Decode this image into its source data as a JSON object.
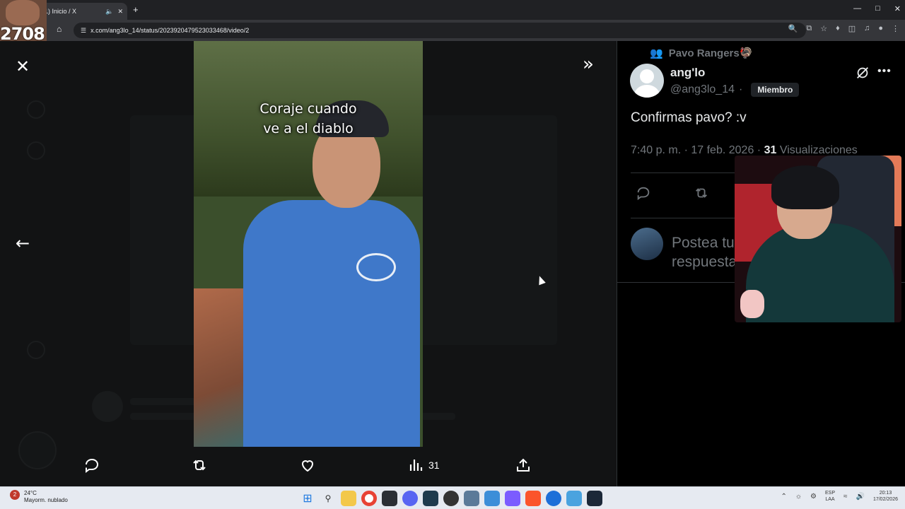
{
  "browser": {
    "tab_title": "(1) Inicio / X",
    "url": "x.com/ang3lo_14/status/2023920479523033468/video/2",
    "new_tab_icon": "plus-icon",
    "window_controls": [
      "minimize-icon",
      "restore-icon",
      "close-icon"
    ]
  },
  "overlay": {
    "streamer_number": "2708"
  },
  "viewer": {
    "video_caption_line1": "Coraje cuando",
    "video_caption_line2": "ve a el diablo",
    "close_icon": "close-icon",
    "expand_icon": "expand-panel-icon",
    "prev_icon": "arrow-left-icon",
    "views_count": "31"
  },
  "tweet": {
    "community": "Pavo Rangers🦃",
    "name": "ang'lo",
    "handle": "@ang3lo_14",
    "separator": "·",
    "member_badge": "Miembro",
    "text": "Confirmas pavo? :v",
    "timestamp": "7:40 p. m. · 17 feb. 2026 ·",
    "views_number": "31",
    "views_label": "Visualizaciones",
    "reply_placeholder": "Postea tu respuesta"
  },
  "taskbar": {
    "temperature": "24°C",
    "weather": "Mayorm. nublado",
    "notification_count": "2",
    "lang_top": "ESP",
    "lang_bottom": "LAA",
    "time": "20:13",
    "date": "17/02/2026"
  },
  "colors": {
    "x_background": "#000000",
    "x_muted": "#71767b",
    "x_text": "#e7e9ea",
    "video_shirt": "#3f78c9"
  }
}
